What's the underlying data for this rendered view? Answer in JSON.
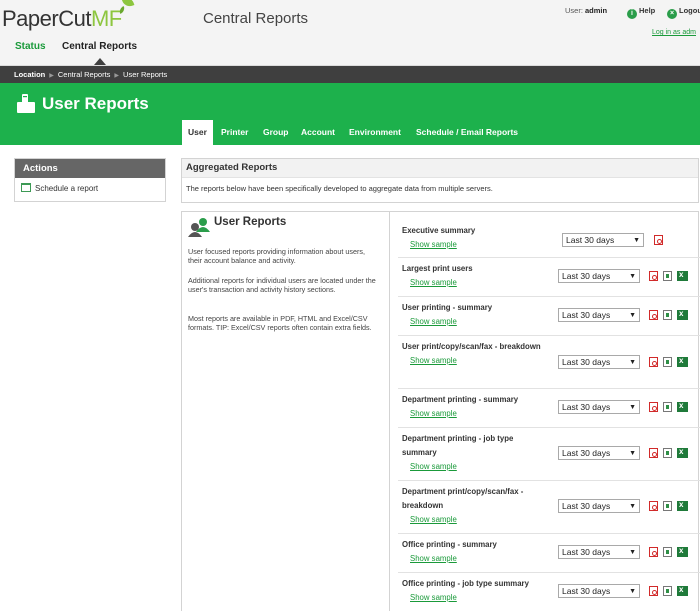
{
  "app": {
    "logo_text_main": "PaperCut",
    "logo_text_accent": "MF",
    "title": "Central Reports"
  },
  "header": {
    "user_label": "User:",
    "user_name": "admin",
    "help": "Help",
    "logout": "Logou",
    "login_as": "Log in as adm"
  },
  "nav": {
    "status": "Status",
    "central_reports": "Central Reports"
  },
  "breadcrumb": [
    "Location",
    "Central Reports",
    "User Reports"
  ],
  "banner": {
    "title": "User Reports",
    "tabs": [
      "User",
      "Printer",
      "Group",
      "Account",
      "Environment",
      "Schedule / Email Reports"
    ]
  },
  "sidebar": {
    "heading": "Actions",
    "item": "Schedule a report"
  },
  "aggregated": {
    "heading": "Aggregated Reports",
    "description": "The reports below have been specifically developed to aggregate data from multiple servers."
  },
  "user_reports": {
    "title": "User Reports",
    "para1": "User focused reports providing information about users, their account balance and activity.",
    "para2": "Additional reports for individual users are located under the user's transaction and activity history sections.",
    "para3": "Most reports are available in PDF, HTML and Excel/CSV formats. TIP: Excel/CSV reports often contain extra fields.",
    "show_sample": "Show sample",
    "period": "Last 30 days",
    "reports": [
      {
        "name": "Executive summary"
      },
      {
        "name": "Largest print users"
      },
      {
        "name": "User printing - summary"
      },
      {
        "name": "User print/copy/scan/fax - breakdown"
      },
      {
        "name": "Department printing - summary"
      },
      {
        "name": "Department printing - job type summary"
      },
      {
        "name": "Department print/copy/scan/fax - breakdown"
      },
      {
        "name": "Office printing - summary"
      },
      {
        "name": "Office printing - job type summary"
      }
    ]
  },
  "colors": {
    "brand_green": "#1db14c",
    "link_green": "#1a9a3a",
    "dark_bar": "#3f3f3f"
  }
}
